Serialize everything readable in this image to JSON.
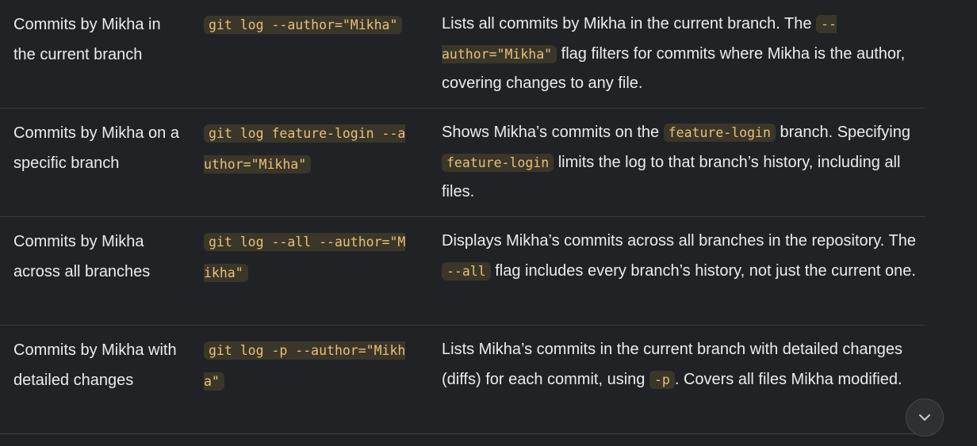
{
  "rows": [
    {
      "label": "Commits by Mikha in the current branch",
      "command": "git log --author=\"Mikha\"",
      "description": [
        {
          "t": "Lists all commits by Mikha in the current branch. The "
        },
        {
          "c": "--author=\"Mikha\""
        },
        {
          "t": " flag filters for commits where Mikha is the author, covering changes to any file."
        }
      ]
    },
    {
      "label": "Commits by Mikha on a specific branch",
      "command": "git log feature-login --author=\"Mikha\"",
      "description": [
        {
          "t": "Shows Mikha’s commits on the "
        },
        {
          "c": "feature-login"
        },
        {
          "t": " branch. Specifying "
        },
        {
          "c": "feature-login"
        },
        {
          "t": " limits the log to that branch’s history, including all files."
        }
      ]
    },
    {
      "label": "Commits by Mikha across all branches",
      "command": "git log --all --author=\"Mikha\"",
      "description": [
        {
          "t": "Displays Mikha’s commits across all branches in the repository. The "
        },
        {
          "c": "--all"
        },
        {
          "t": " flag includes every branch’s history, not just the current one."
        }
      ]
    },
    {
      "label": "Commits by Mikha with detailed changes",
      "command": "git log -p --author=\"Mikha\"",
      "description": [
        {
          "t": "Lists Mikha’s commits in the current branch with detailed changes (diffs) for each commit, using "
        },
        {
          "c": "-p"
        },
        {
          "t": ". Covers all files Mikha modified."
        }
      ]
    }
  ],
  "colors": {
    "background": "#212226",
    "code_bg": "#3a3629",
    "code_text": "#e9c07a"
  }
}
